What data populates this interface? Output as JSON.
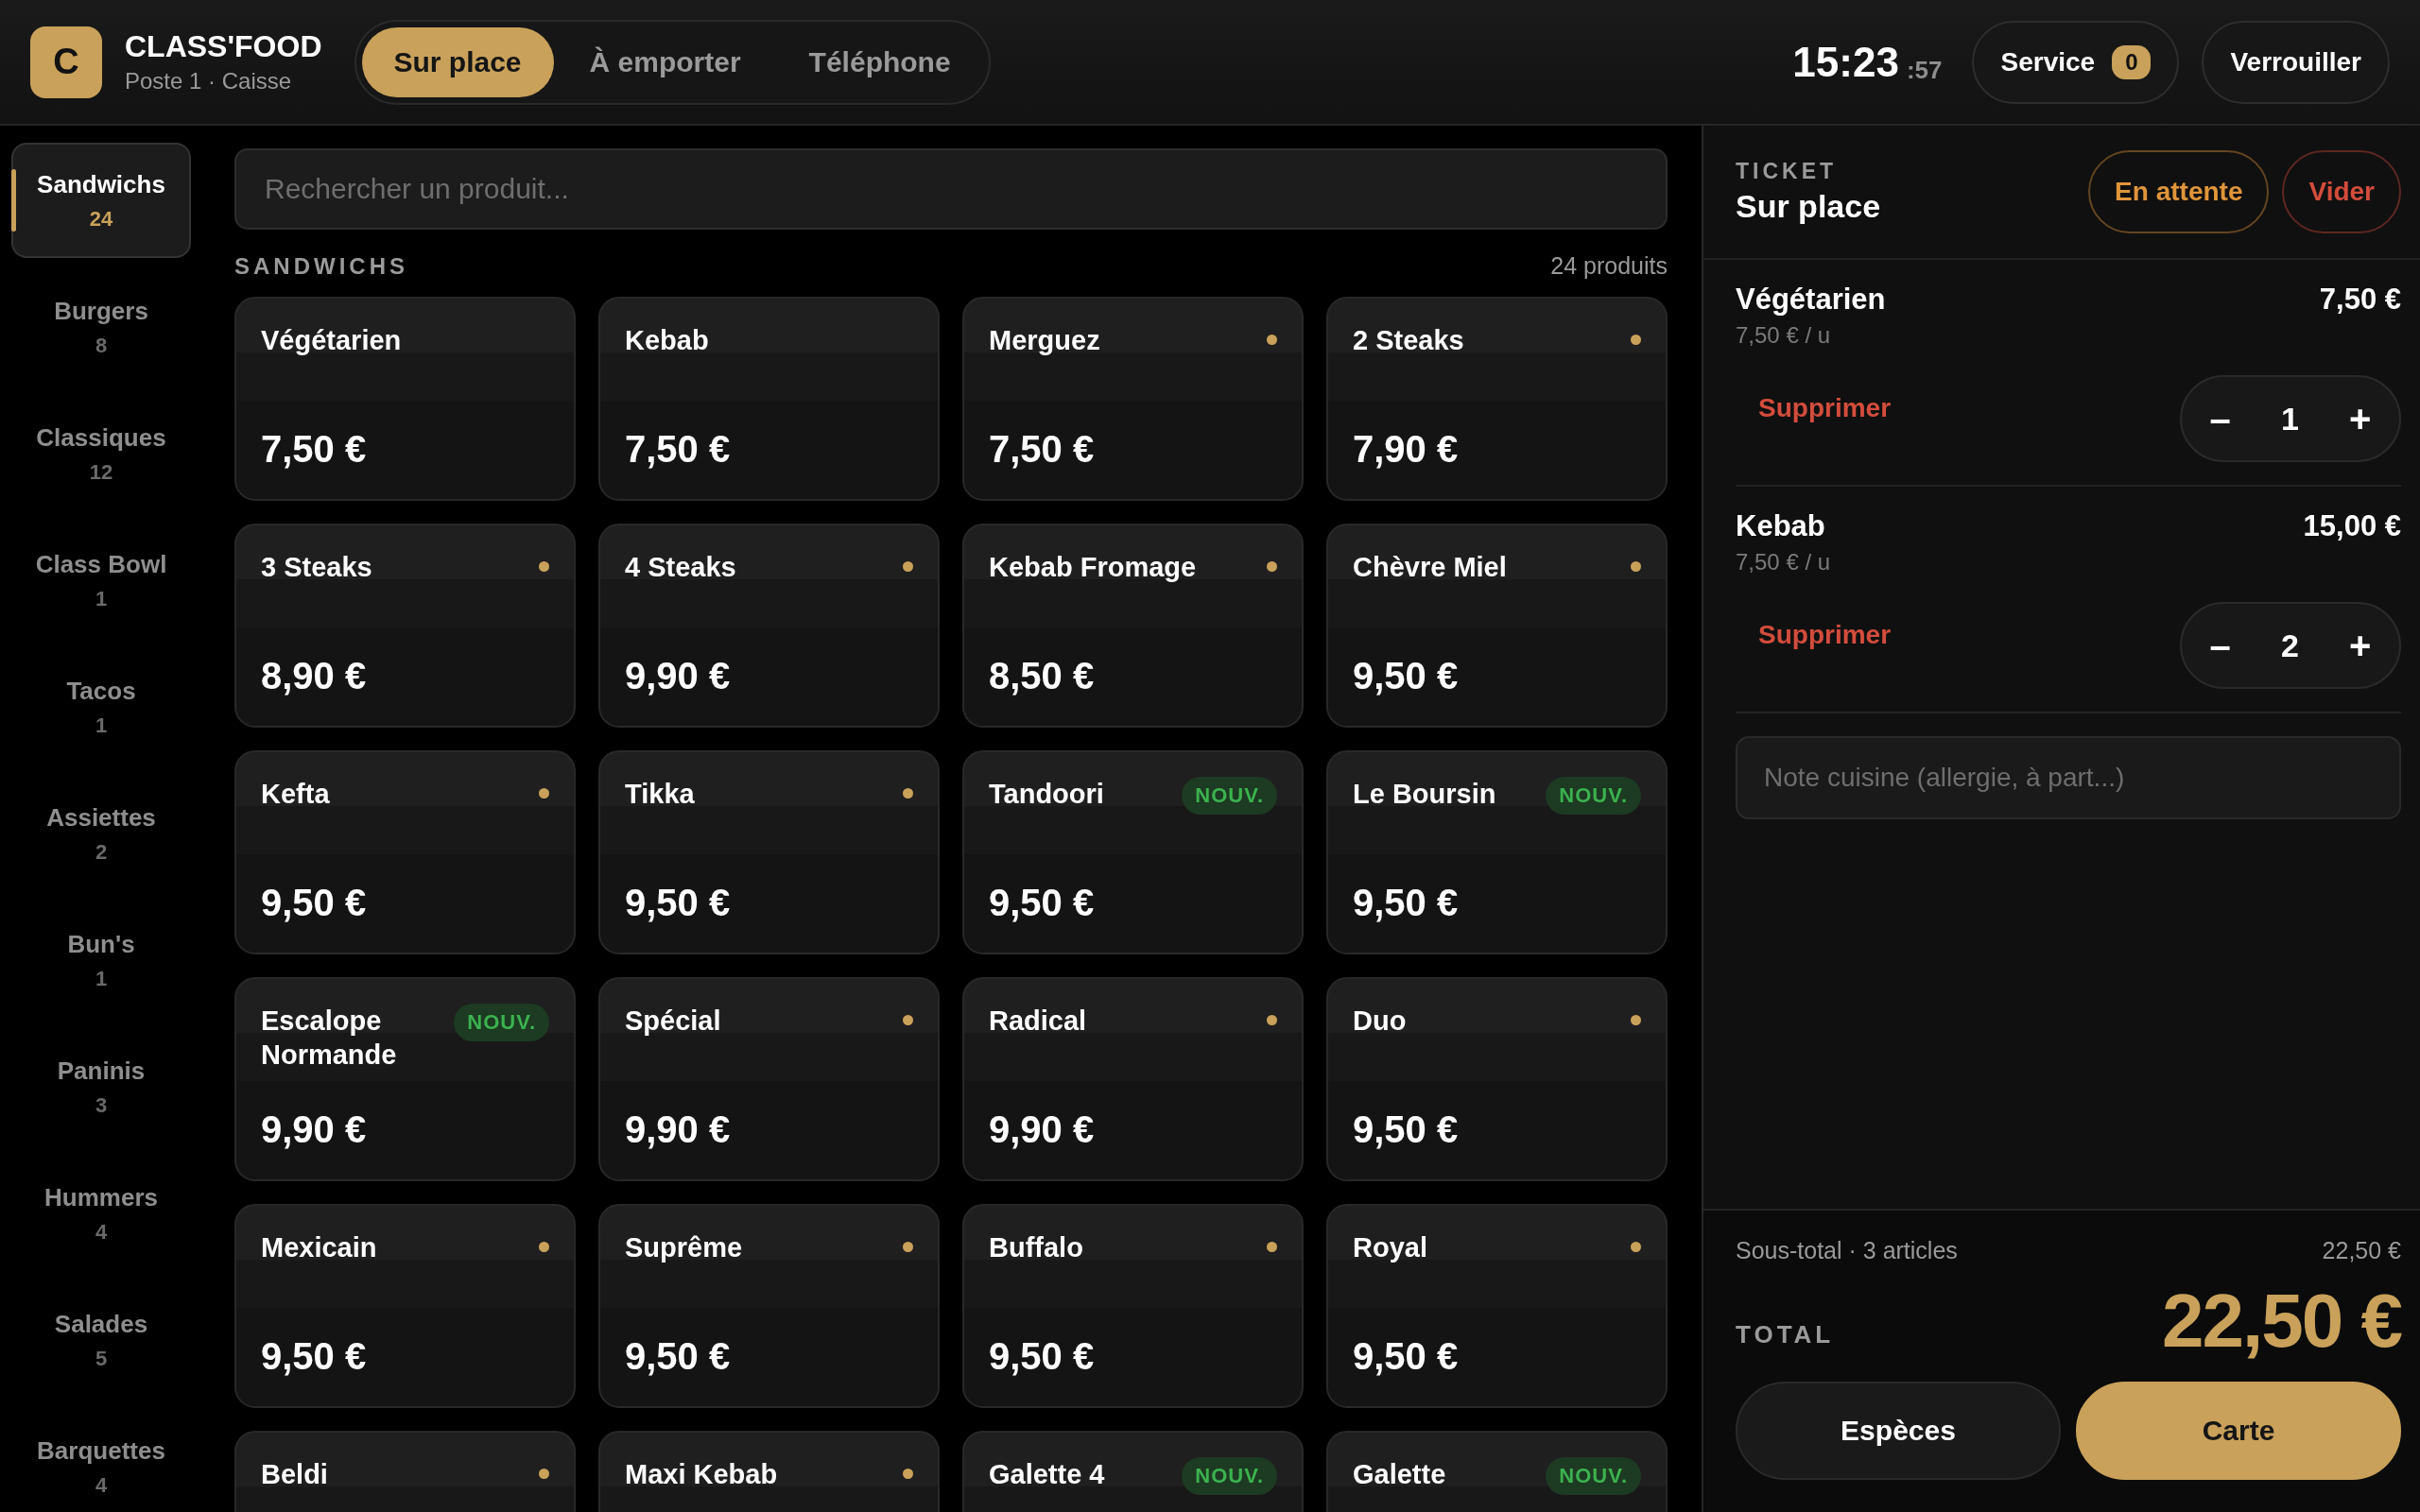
{
  "brand": {
    "logo": "C",
    "name": "CLASS'FOOD",
    "subtitle": "Poste 1 · Caisse"
  },
  "modes": [
    {
      "label": "Sur place",
      "selected": true
    },
    {
      "label": "À emporter",
      "selected": false
    },
    {
      "label": "Téléphone",
      "selected": false
    }
  ],
  "clock": {
    "time": "15:23",
    "seconds": ":57"
  },
  "service": {
    "label": "Service",
    "count": "0"
  },
  "lock_button": "Verrouiller",
  "categories": [
    {
      "label": "Sandwichs",
      "count": "24",
      "selected": true
    },
    {
      "label": "Burgers",
      "count": "8",
      "selected": false
    },
    {
      "label": "Classiques",
      "count": "12",
      "selected": false
    },
    {
      "label": "Class Bowl",
      "count": "1",
      "selected": false
    },
    {
      "label": "Tacos",
      "count": "1",
      "selected": false
    },
    {
      "label": "Assiettes",
      "count": "2",
      "selected": false
    },
    {
      "label": "Bun's",
      "count": "1",
      "selected": false
    },
    {
      "label": "Paninis",
      "count": "3",
      "selected": false
    },
    {
      "label": "Hummers",
      "count": "4",
      "selected": false
    },
    {
      "label": "Salades",
      "count": "5",
      "selected": false
    },
    {
      "label": "Barquettes",
      "count": "4",
      "selected": false
    }
  ],
  "search": {
    "placeholder": "Rechercher un produit..."
  },
  "section": {
    "title": "SANDWICHS",
    "count": "24 produits"
  },
  "products": [
    {
      "name": "Végétarien",
      "price": "7,50 €",
      "dot": false
    },
    {
      "name": "Kebab",
      "price": "7,50 €",
      "dot": false
    },
    {
      "name": "Merguez",
      "price": "7,50 €",
      "dot": true
    },
    {
      "name": "2 Steaks",
      "price": "7,90 €",
      "dot": true
    },
    {
      "name": "3 Steaks",
      "price": "8,90 €",
      "dot": true
    },
    {
      "name": "4 Steaks",
      "price": "9,90 €",
      "dot": true
    },
    {
      "name": "Kebab Fromage",
      "price": "8,50 €",
      "dot": true
    },
    {
      "name": "Chèvre Miel",
      "price": "9,50 €",
      "dot": true
    },
    {
      "name": "Kefta",
      "price": "9,50 €",
      "dot": true
    },
    {
      "name": "Tikka",
      "price": "9,50 €",
      "dot": true
    },
    {
      "name": "Tandoori",
      "price": "9,50 €",
      "dot": false,
      "badge": "NOUV."
    },
    {
      "name": "Le Boursin",
      "price": "9,50 €",
      "dot": false,
      "badge": "NOUV."
    },
    {
      "name": "Escalope Normande",
      "price": "9,90 €",
      "dot": false,
      "badge": "NOUV."
    },
    {
      "name": "Spécial",
      "price": "9,90 €",
      "dot": true
    },
    {
      "name": "Radical",
      "price": "9,90 €",
      "dot": true
    },
    {
      "name": "Duo",
      "price": "9,50 €",
      "dot": true
    },
    {
      "name": "Mexicain",
      "price": "9,50 €",
      "dot": true
    },
    {
      "name": "Suprême",
      "price": "9,50 €",
      "dot": true
    },
    {
      "name": "Buffalo",
      "price": "9,50 €",
      "dot": true
    },
    {
      "name": "Royal",
      "price": "9,50 €",
      "dot": true
    },
    {
      "name": "Beldi",
      "dot": true
    },
    {
      "name": "Maxi Kebab",
      "dot": true
    },
    {
      "name": "Galette 4",
      "dot": false,
      "badge": "NOUV."
    },
    {
      "name": "Galette",
      "dot": false,
      "badge": "NOUV."
    }
  ],
  "ticket": {
    "label": "TICKET",
    "mode": "Sur place",
    "hold_button": "En attente",
    "clear_button": "Vider",
    "lines": [
      {
        "name": "Végétarien",
        "total": "7,50 €",
        "unit": "7,50 € / u",
        "remove": "Supprimer",
        "minus": "–",
        "qty": "1",
        "plus": "+"
      },
      {
        "name": "Kebab",
        "total": "15,00 €",
        "unit": "7,50 € / u",
        "remove": "Supprimer",
        "minus": "–",
        "qty": "2",
        "plus": "+"
      }
    ],
    "note": {
      "placeholder": "Note cuisine (allergie, à part...)"
    },
    "subtotal_label": "Sous-total · 3 articles",
    "subtotal": "22,50 €",
    "total_label": "TOTAL",
    "total": "22,50 €",
    "pay_buttons": [
      {
        "label": "Espèces",
        "kind": "secondary"
      },
      {
        "label": "Carte",
        "kind": "primary"
      }
    ]
  }
}
